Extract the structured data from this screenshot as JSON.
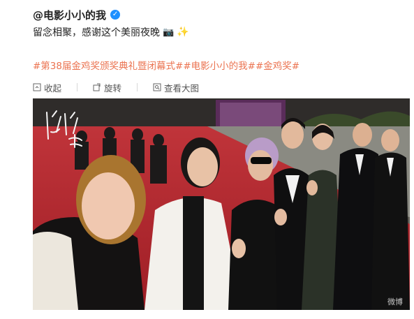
{
  "author": {
    "name": "@电影小小的我",
    "verified_glyph": "✓"
  },
  "caption": {
    "text": "留念相聚，感谢这个美丽夜晚"
  },
  "tags": [
    "#第38届金鸡奖颁奖典礼暨闭幕式#",
    "#电影小小的我#",
    "#金鸡奖#"
  ],
  "actions": {
    "collapse": "收起",
    "repost": "旋转",
    "view_large": "查看大图"
  },
  "photo": {
    "alt": "红毯合影",
    "signature_text": "小小的我",
    "watermark": "微博"
  },
  "colors": {
    "tag": "#eb7350",
    "verified": "#1e90ff",
    "carpet": "#b3242a"
  }
}
